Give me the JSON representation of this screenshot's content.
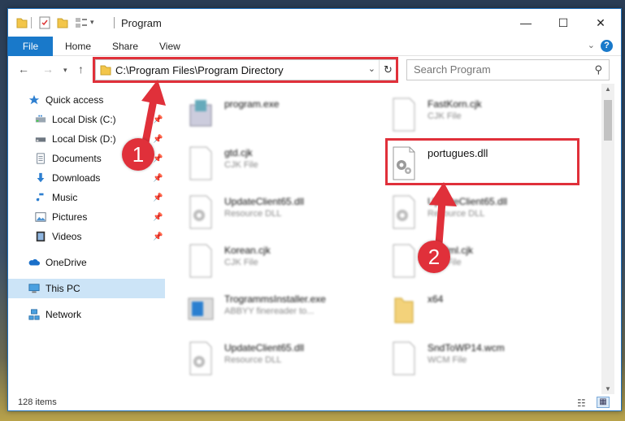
{
  "window": {
    "title": "Program",
    "minimize": "—",
    "maximize": "☐",
    "close": "✕"
  },
  "ribbon": {
    "file_tab": "File",
    "tabs": [
      "Home",
      "Share",
      "View"
    ],
    "help": "?"
  },
  "nav": {
    "address": "C:\\Program Files\\Program Directory",
    "search_placeholder": "Search Program"
  },
  "sidebar": {
    "items": [
      {
        "label": "Quick access",
        "icon": "star-icon"
      },
      {
        "label": "Local Disk (C:)",
        "icon": "drive-icon",
        "pinned": true
      },
      {
        "label": "Local Disk (D:)",
        "icon": "drive-icon",
        "pinned": true
      },
      {
        "label": "Documents",
        "icon": "documents-icon",
        "pinned": true
      },
      {
        "label": "Downloads",
        "icon": "downloads-icon",
        "pinned": true
      },
      {
        "label": "Music",
        "icon": "music-icon",
        "pinned": true
      },
      {
        "label": "Pictures",
        "icon": "pictures-icon",
        "pinned": true
      },
      {
        "label": "Videos",
        "icon": "videos-icon",
        "pinned": true
      },
      {
        "label": "OneDrive",
        "icon": "onedrive-icon"
      },
      {
        "label": "This PC",
        "icon": "pc-icon",
        "selected": true
      },
      {
        "label": "Network",
        "icon": "network-icon"
      }
    ]
  },
  "files": [
    {
      "name": "program.exe",
      "type": ""
    },
    {
      "name": "FastKorn.cjk",
      "type": "CJK File"
    },
    {
      "name": "gtd.cjk",
      "type": "CJK File"
    },
    {
      "name": "portugues.dll",
      "type": ""
    },
    {
      "name": "UpdateClient65.dll",
      "type": "Resource DLL"
    },
    {
      "name": "UpdateClient65.dll",
      "type": "Resource DLL"
    },
    {
      "name": "Korean.cjk",
      "type": "CJK File"
    },
    {
      "name": "gotNml.cjk",
      "type": "CJK File"
    },
    {
      "name": "TrogrammsInstaller.exe",
      "type": "ABBYY finereader to..."
    },
    {
      "name": "x64",
      "type": ""
    },
    {
      "name": "UpdateClient65.dll",
      "type": "Resource DLL"
    },
    {
      "name": "SndToWP14.wcm",
      "type": "WCM File"
    }
  ],
  "status": {
    "items_count": "128 items"
  },
  "annotations": {
    "step1": "1",
    "step2": "2"
  },
  "colors": {
    "accent": "#1979ca",
    "highlight": "#e0303a",
    "selected": "#cce4f7"
  }
}
